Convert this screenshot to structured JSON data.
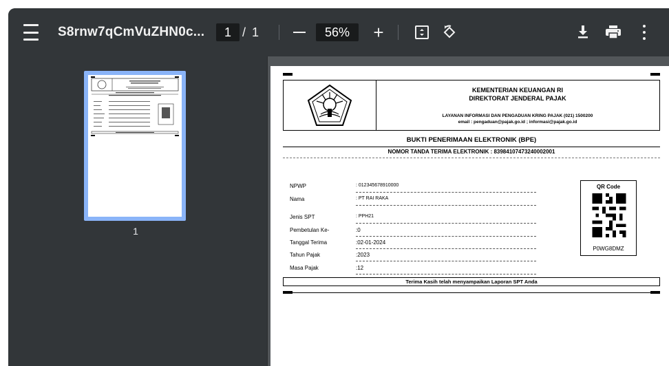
{
  "toolbar": {
    "title": "S8rnw7qCmVuZHN0c...",
    "current_page": "1",
    "page_separator": "/",
    "total_pages": "1",
    "zoom": "56%",
    "zoom_in_symbol": "+"
  },
  "sidebar": {
    "thumbnail_label": "1"
  },
  "document": {
    "header_line1": "KEMENTERIAN KEUANGAN RI",
    "header_line2": "DIREKTORAT JENDERAL PAJAK",
    "header_line3": "LAYANAN INFORMASI DAN PENGADUAN KRING PAJAK (021) 1500200",
    "header_line4": "email : pengaduan@pajak.go.id ; informasi@pajak.go.id",
    "title": "BUKTI PENERIMAAN ELEKTRONIK (BPE)",
    "receipt_number": "NOMOR TANDA TERIMA ELEKTRONIK : 839841074732400020​01",
    "fields": [
      {
        "label": "NPWP",
        "value": ": 012345678910000"
      },
      {
        "label": "Nama",
        "value": ": PT RAI RAKA"
      },
      {
        "label": "Jenis SPT",
        "value": ": PPH21"
      },
      {
        "label": "Pembetulan Ke-",
        "value": ":0"
      },
      {
        "label": "Tanggal Terima",
        "value": ":02-01-2024"
      },
      {
        "label": "Tahun Pajak",
        "value": ":2023"
      },
      {
        "label": "Masa Pajak",
        "value": ":12"
      }
    ],
    "qr_title": "QR Code",
    "qr_value": "P0WG8DMZ",
    "thanks": "Terima Kasih telah menyampaikan Laporan SPT Anda"
  }
}
